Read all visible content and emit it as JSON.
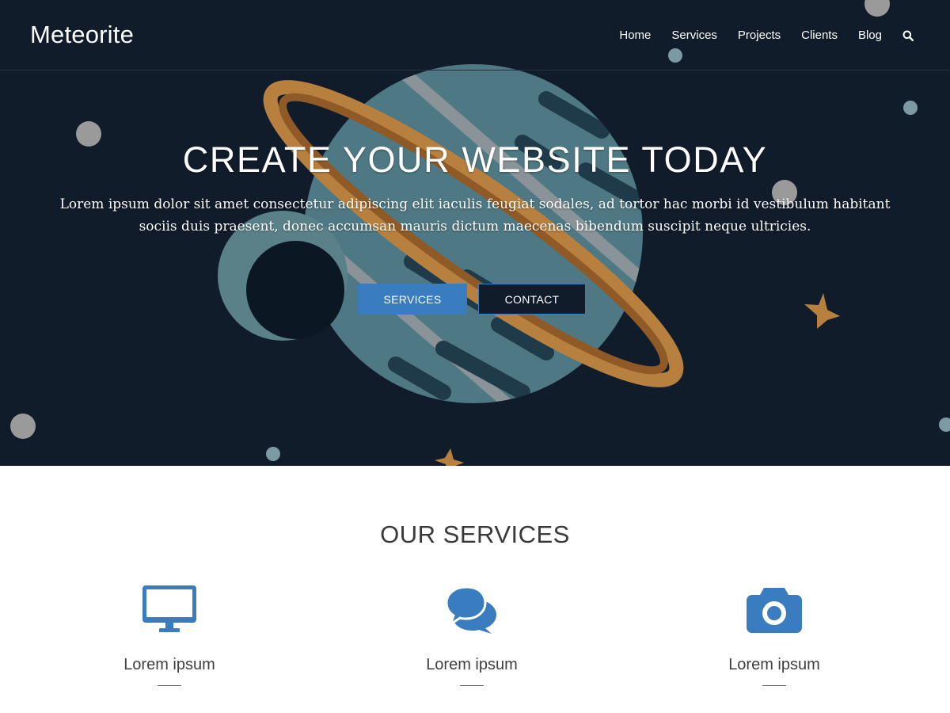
{
  "brand": "Meteorite",
  "nav": {
    "items": [
      "Home",
      "Services",
      "Projects",
      "Clients",
      "Blog"
    ],
    "search_icon": "search-icon"
  },
  "hero": {
    "title": "CREATE YOUR WEBSITE TODAY",
    "text": "Lorem ipsum dolor sit amet consectetur adipiscing elit iaculis feugiat sodales, ad tortor hac morbi id vestibulum habitant sociis duis praesent, donec accumsan mauris dictum maecenas bibendum suscipit neque ultricies.",
    "buttons": {
      "services": "SERVICES",
      "contact": "CONTACT"
    }
  },
  "services": {
    "title": "OUR SERVICES",
    "items": [
      {
        "icon": "monitor-icon",
        "title": "Lorem ipsum"
      },
      {
        "icon": "chat-bubbles-icon",
        "title": "Lorem ipsum"
      },
      {
        "icon": "camera-icon",
        "title": "Lorem ipsum"
      }
    ]
  },
  "colors": {
    "hero_background": "#111c2b",
    "accent": "#3a7cc0",
    "planet": "#4e7883",
    "ring": "#b8803f"
  }
}
